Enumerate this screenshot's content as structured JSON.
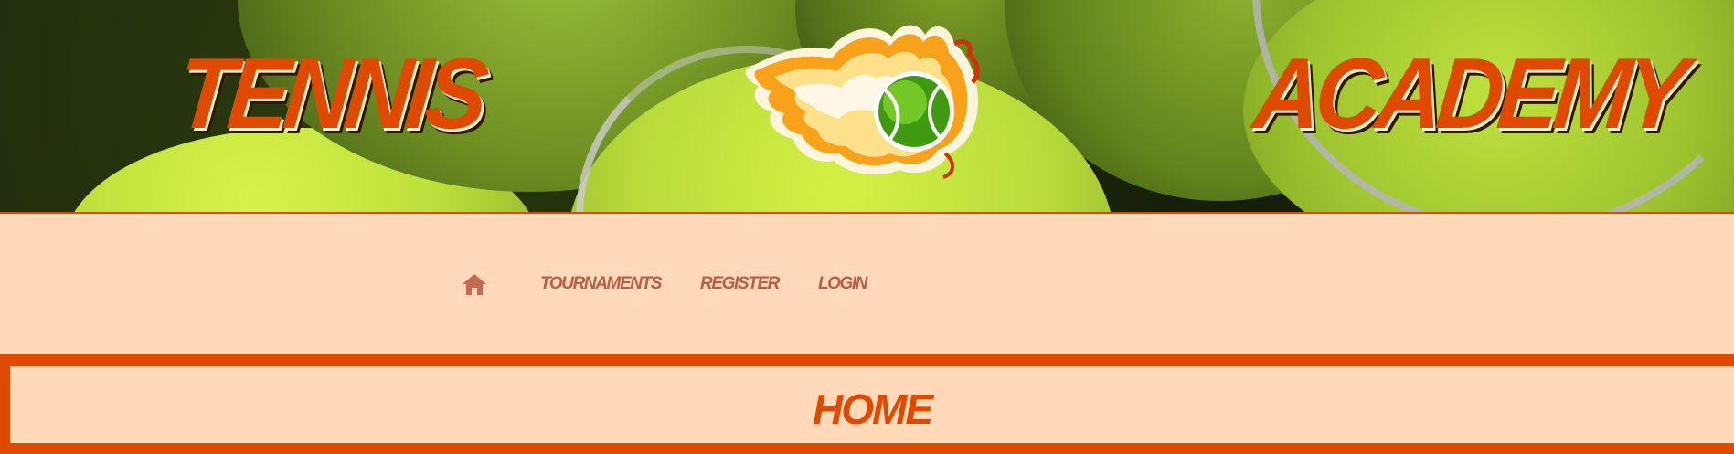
{
  "banner": {
    "left_word": "TENNIS",
    "right_word": "ACADEMY",
    "logo_icon": "flaming-tennis-ball-icon"
  },
  "nav": {
    "home_icon": "home-icon",
    "items": [
      {
        "label": "TOURNAMENTS"
      },
      {
        "label": "REGISTER"
      },
      {
        "label": "LOGIN"
      }
    ]
  },
  "page": {
    "heading": "HOME"
  },
  "colors": {
    "accent": "#e04a00",
    "background": "#ffd9b8",
    "nav_text": "#b5604a"
  }
}
